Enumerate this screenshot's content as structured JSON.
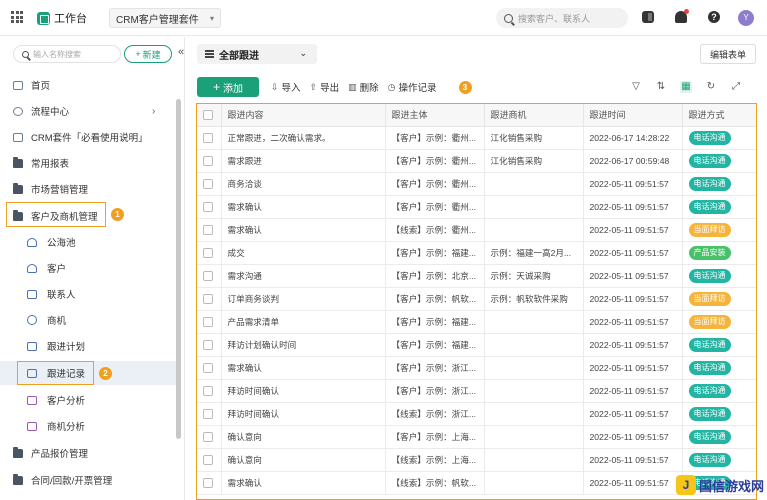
{
  "topbar": {
    "brand": "工作台",
    "suite": "CRM客户管理套件",
    "search_placeholder": "搜索客户、联系人",
    "avatar": "Y"
  },
  "sidebar": {
    "search_placeholder": "输入名称搜索",
    "new_button": "新建",
    "items": [
      {
        "label": "首页"
      },
      {
        "label": "流程中心"
      },
      {
        "label": "CRM套件「必看使用说明」"
      },
      {
        "label": "常用报表"
      },
      {
        "label": "市场营销管理"
      },
      {
        "label": "客户及商机管理"
      },
      {
        "label": "公海池"
      },
      {
        "label": "客户"
      },
      {
        "label": "联系人"
      },
      {
        "label": "商机"
      },
      {
        "label": "跟进计划"
      },
      {
        "label": "跟进记录"
      },
      {
        "label": "客户分析"
      },
      {
        "label": "商机分析"
      },
      {
        "label": "产品报价管理"
      },
      {
        "label": "合同/回款/开票管理"
      }
    ],
    "annotations": [
      "1",
      "2"
    ]
  },
  "main": {
    "view_label": "全部跟进",
    "edit_form": "编辑表单",
    "toolbar": {
      "add": "添加",
      "import": "导入",
      "export": "导出",
      "delete": "删除",
      "log": "操作记录",
      "annotation": "3"
    },
    "columns": [
      "跟进内容",
      "跟进主体",
      "跟进商机",
      "跟进时间",
      "跟进方式"
    ],
    "rows": [
      {
        "content": "正常跟进，二次确认需求。",
        "subject": "【客户】示例：衢州...",
        "opp": "江化销售采购",
        "time": "2022-06-17 14:28:22",
        "method": "电话沟通",
        "color": "teal"
      },
      {
        "content": "需求跟进",
        "subject": "【客户】示例：衢州...",
        "opp": "江化销售采购",
        "time": "2022-06-17 00:59:48",
        "method": "电话沟通",
        "color": "teal"
      },
      {
        "content": "商务洽谈",
        "subject": "【客户】示例：衢州...",
        "opp": "",
        "time": "2022-05-11 09:51:57",
        "method": "电话沟通",
        "color": "teal"
      },
      {
        "content": "需求确认",
        "subject": "【客户】示例：衢州...",
        "opp": "",
        "time": "2022-05-11 09:51:57",
        "method": "电话沟通",
        "color": "teal"
      },
      {
        "content": "需求确认",
        "subject": "【线索】示例：衢州...",
        "opp": "",
        "time": "2022-05-11 09:51:57",
        "method": "当面拜访",
        "color": "orange"
      },
      {
        "content": "成交",
        "subject": "【客户】示例：福建...",
        "opp": "示例：福建一高2月...",
        "time": "2022-05-11 09:51:57",
        "method": "产品安装",
        "color": "green"
      },
      {
        "content": "需求沟通",
        "subject": "【客户】示例：北京...",
        "opp": "示例：天诚采购",
        "time": "2022-05-11 09:51:57",
        "method": "电话沟通",
        "color": "teal"
      },
      {
        "content": "订单商务谈判",
        "subject": "【客户】示例：帆软...",
        "opp": "示例：帆软软件采购",
        "time": "2022-05-11 09:51:57",
        "method": "当面拜访",
        "color": "orange"
      },
      {
        "content": "产品需求清单",
        "subject": "【客户】示例：福建...",
        "opp": "",
        "time": "2022-05-11 09:51:57",
        "method": "当面拜访",
        "color": "orange"
      },
      {
        "content": "拜访计划确认时间",
        "subject": "【客户】示例：福建...",
        "opp": "",
        "time": "2022-05-11 09:51:57",
        "method": "电话沟通",
        "color": "teal"
      },
      {
        "content": "需求确认",
        "subject": "【客户】示例：浙江...",
        "opp": "",
        "time": "2022-05-11 09:51:57",
        "method": "电话沟通",
        "color": "teal"
      },
      {
        "content": "拜访时间确认",
        "subject": "【客户】示例：浙江...",
        "opp": "",
        "time": "2022-05-11 09:51:57",
        "method": "电话沟通",
        "color": "teal"
      },
      {
        "content": "拜访时间确认",
        "subject": "【线索】示例：浙江...",
        "opp": "",
        "time": "2022-05-11 09:51:57",
        "method": "电话沟通",
        "color": "teal"
      },
      {
        "content": "确认意向",
        "subject": "【客户】示例：上海...",
        "opp": "",
        "time": "2022-05-11 09:51:57",
        "method": "电话沟通",
        "color": "teal"
      },
      {
        "content": "确认意向",
        "subject": "【线索】示例：上海...",
        "opp": "",
        "time": "2022-05-11 09:51:57",
        "method": "电话沟通",
        "color": "teal"
      },
      {
        "content": "需求确认",
        "subject": "【线索】示例：帆软...",
        "opp": "",
        "time": "2022-05-11 09:51:57",
        "method": "电话沟通",
        "color": "teal"
      }
    ]
  },
  "watermark": {
    "logo": "J",
    "text": "国信游戏网"
  },
  "colors": {
    "brand": "#1aa17a",
    "highlight": "#f0a020",
    "teal": "#22b5a3",
    "orange": "#f5b43c",
    "green": "#48c268"
  }
}
